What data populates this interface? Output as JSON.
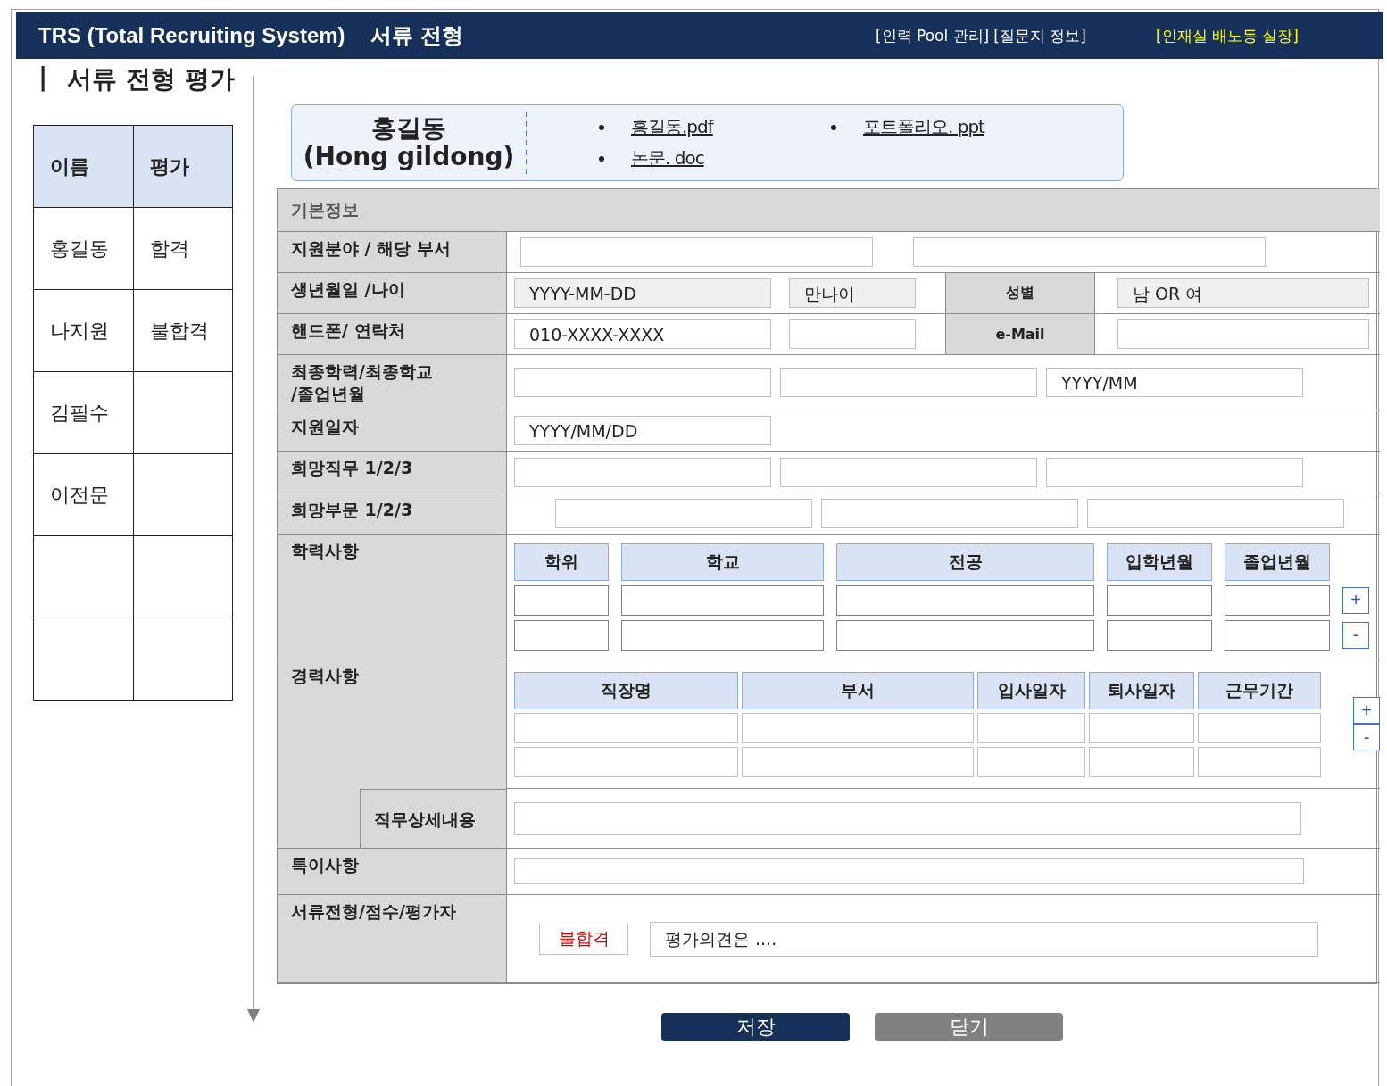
{
  "header": {
    "title": "TRS (Total Recruiting System)",
    "subtitle": "서류 전형",
    "links": [
      "[인력 Pool 관리]",
      "[질문지 정보]"
    ],
    "user": "[인재실  배노동 실장]"
  },
  "page_title": {
    "mark": "|",
    "text": "서류 전형 평가"
  },
  "candidates": {
    "columns": [
      "이름",
      "평가"
    ],
    "rows": [
      {
        "name": "홍길동",
        "result": "합격",
        "selected": false
      },
      {
        "name": "나지원",
        "result": "불합격",
        "selected": false
      },
      {
        "name": "김필수",
        "selected": false
      },
      {
        "name": "이전문",
        "selected": false
      },
      {
        "selected": false
      },
      {
        "selected": false
      }
    ]
  },
  "applicant": {
    "name": "홍길동",
    "name_en": "(Hong gildong)",
    "files": [
      "홍길동.pdf",
      "논문. doc",
      "포트폴리오. ppt"
    ]
  },
  "form": {
    "section": "기본정보",
    "rows": [
      {
        "kind": "pair",
        "label": "지원분야 / 해당 부서",
        "fields": [
          {
            "disabled": false
          },
          {
            "disabled": false
          }
        ]
      },
      {
        "kind": "split",
        "label": "생년월일 /나이",
        "fields": [
          {
            "placeholder": "YYYY-MM-DD",
            "disabled": true
          },
          {
            "placeholder": "만나이",
            "disabled": true
          }
        ],
        "side_label": "성별",
        "side_field": {
          "placeholder": "남 OR 여",
          "disabled": true
        }
      },
      {
        "kind": "split",
        "label": "핸드폰/ 연락처",
        "fields": [
          {
            "placeholder": "010-XXXX-XXXX",
            "disabled": false
          },
          {
            "disabled": false
          }
        ],
        "side_label": "e-Mail",
        "side_field": {
          "disabled": false
        }
      },
      {
        "kind": "triple",
        "label": "최종학력/최종학교\n/졸업년월",
        "fields": [
          {
            "disabled": false
          },
          {
            "disabled": false
          },
          {
            "placeholder": "YYYY/MM",
            "disabled": false
          }
        ]
      },
      {
        "kind": "single",
        "label": "지원일자",
        "fields": [
          {
            "placeholder": "YYYY/MM/DD",
            "disabled": false
          }
        ]
      },
      {
        "kind": "triple",
        "label": "희망직무 1/2/3",
        "fields": [
          {
            "disabled": false
          },
          {
            "disabled": false
          },
          {
            "disabled": false
          }
        ]
      },
      {
        "kind": "offset",
        "label": "희망부문 1/2/3",
        "fields": [
          {
            "disabled": false
          },
          {
            "disabled": false
          },
          {
            "disabled": false
          }
        ]
      },
      {
        "kind": "education",
        "label": "학력사항",
        "columns": [
          "학위",
          "학교",
          "전공",
          "입학년월",
          "졸업년월"
        ],
        "entries": [
          {
            "disabled": false
          },
          {
            "disabled": false
          }
        ],
        "add": "+",
        "remove": "-"
      },
      {
        "kind": "career",
        "label": "경력사항",
        "columns": [
          "직장명",
          "부서",
          "입사일자",
          "퇴사일자",
          "근무기간"
        ],
        "entries": [
          {
            "disabled": false
          },
          {
            "disabled": false
          }
        ],
        "add": "+",
        "remove": "-",
        "detail_label": "직무상세내용"
      },
      {
        "kind": "wide",
        "label": "특이사항"
      },
      {
        "kind": "evaluation",
        "label": "서류전형/점수/평가자",
        "result": "불합격",
        "comment_placeholder": "평가의견은 ...."
      }
    ]
  },
  "buttons": [
    {
      "label": "저장",
      "kind": "primary"
    },
    {
      "label": "닫기",
      "kind": "secondary"
    }
  ]
}
